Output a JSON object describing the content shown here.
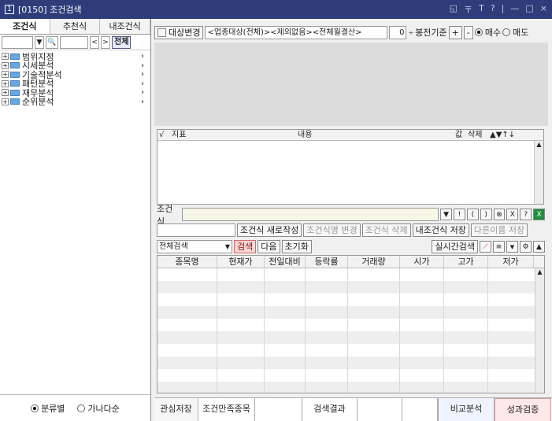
{
  "window": {
    "title": "[0150] 조건검색",
    "icon": "1",
    "controls": [
      "◱",
      "〒",
      "T",
      "?",
      "|",
      "—",
      "□",
      "×"
    ]
  },
  "left": {
    "tabs": [
      "조건식",
      "추천식",
      "내조건식"
    ],
    "search": {
      "dropdown_icon": "▼",
      "search_icon": "🔍",
      "prev": "<",
      "next": ">",
      "all_label": "전체"
    },
    "tree": [
      "범위지정",
      "시세분석",
      "기술적분석",
      "패턴분석",
      "재무분석",
      "순위분석"
    ],
    "footer": {
      "opt1": "분류별",
      "opt2": "가나다순"
    }
  },
  "right": {
    "condbar": {
      "target_btn": "대상변경",
      "target_text": "<업종대상(전체)><제외없음><전체월결산>",
      "bong_value": "0",
      "bong_label": "봉전기준",
      "plus": "+",
      "minus": "-",
      "buy": "매수",
      "sell": "매도"
    },
    "index_table": {
      "check": "√",
      "col_index": "지표",
      "col_content": "내용",
      "col_value": "값",
      "col_delete": "삭제",
      "sort_icons": "▲▼↑↓"
    },
    "cond_label": "조건식",
    "cond_icons": [
      "▼",
      "!",
      "(",
      ")",
      "⊗",
      "X",
      "?"
    ],
    "actions": {
      "new": "조건식 새로작성",
      "rename": "조건식명 변경",
      "delete": "조건식 삭제",
      "save": "내조건식 저장",
      "save_as": "다른이름 저장"
    },
    "search": {
      "scope": "전체검색",
      "search_btn": "검색",
      "next_btn": "다음",
      "reset_btn": "초기화",
      "realtime_btn": "실시간검색"
    },
    "columns": [
      "종목명",
      "현재가",
      "전일대비",
      "등락률",
      "거래량",
      "시가",
      "고가",
      "저가"
    ],
    "bottom_tabs": {
      "fav_save": "관심저장",
      "cond_register": "조건만족종목",
      "result": "검색결과",
      "compare": "비교분석",
      "verify": "성과검증"
    }
  },
  "colors": {
    "title_bg": "#2e3d7a",
    "accent_red": "#d26b6b",
    "folder": "#6aa7e0",
    "excel_green": "#1e8f3e"
  }
}
